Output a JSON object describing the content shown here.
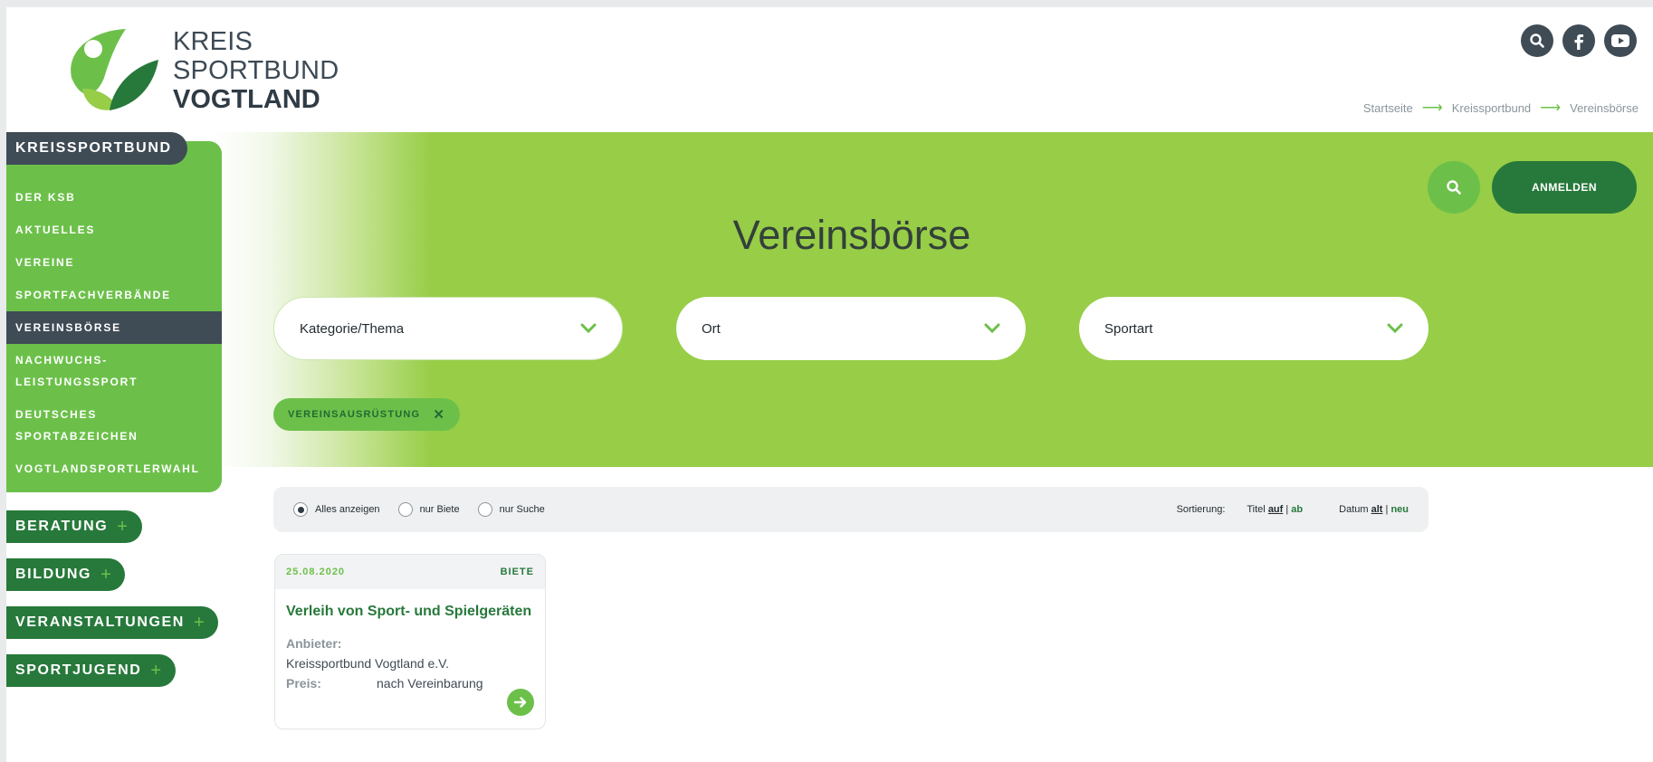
{
  "header": {
    "logo_line1": "KREIS",
    "logo_line2": "SPORTBUND",
    "logo_line3": "VOGTLAND",
    "social": [
      "search-icon",
      "facebook-icon",
      "youtube-icon"
    ],
    "breadcrumb": [
      "Startseite",
      "Kreissportbund",
      "Vereinsbörse"
    ]
  },
  "hero": {
    "title": "Vereinsbörse",
    "login_label": "ANMELDEN",
    "selects": [
      {
        "value": "Kategorie/Thema"
      },
      {
        "value": "Ort"
      },
      {
        "value": "Sportart"
      }
    ],
    "active_filter": "VEREINSAUSRÜSTUNG"
  },
  "sidebar": {
    "head": "KREISSPORTBUND",
    "items": [
      {
        "label": "DER KSB"
      },
      {
        "label": "AKTUELLES"
      },
      {
        "label": "VEREINE"
      },
      {
        "label": "SPORTFACHVERBÄNDE"
      },
      {
        "label": "VEREINSBÖRSE",
        "active": true
      },
      {
        "label_a": "NACHWUCHS-",
        "label_b": "LEISTUNGSSPORT"
      },
      {
        "label_a": "DEUTSCHES",
        "label_b": "SPORTABZEICHEN"
      },
      {
        "label": "VOGTLANDSPORTLERWAHL"
      }
    ],
    "main": [
      "BERATUNG",
      "BILDUNG",
      "VERANSTALTUNGEN",
      "SPORTJUGEND"
    ]
  },
  "filter": {
    "radios": [
      "Alles anzeigen",
      "nur Biete",
      "nur Suche"
    ],
    "sort_label": "Sortierung:",
    "sort_title": "Titel",
    "sort_title_asc": "auf",
    "sort_title_desc": "ab",
    "sort_date": "Datum",
    "sort_date_old": "alt",
    "sort_date_new": "neu",
    "sep": "|"
  },
  "card": {
    "date": "25.08.2020",
    "type": "BIETE",
    "title": "Verleih von Sport- und Spielgeräten",
    "provider_label": "Anbieter:",
    "provider": "Kreissportbund Vogtland e.V.",
    "price_label": "Preis:",
    "price": "nach Vereinbarung"
  },
  "colors": {
    "green_light": "#6cc04a",
    "green_hero": "#97cd47",
    "green_dark": "#27793b",
    "slate": "#3f4b55"
  }
}
